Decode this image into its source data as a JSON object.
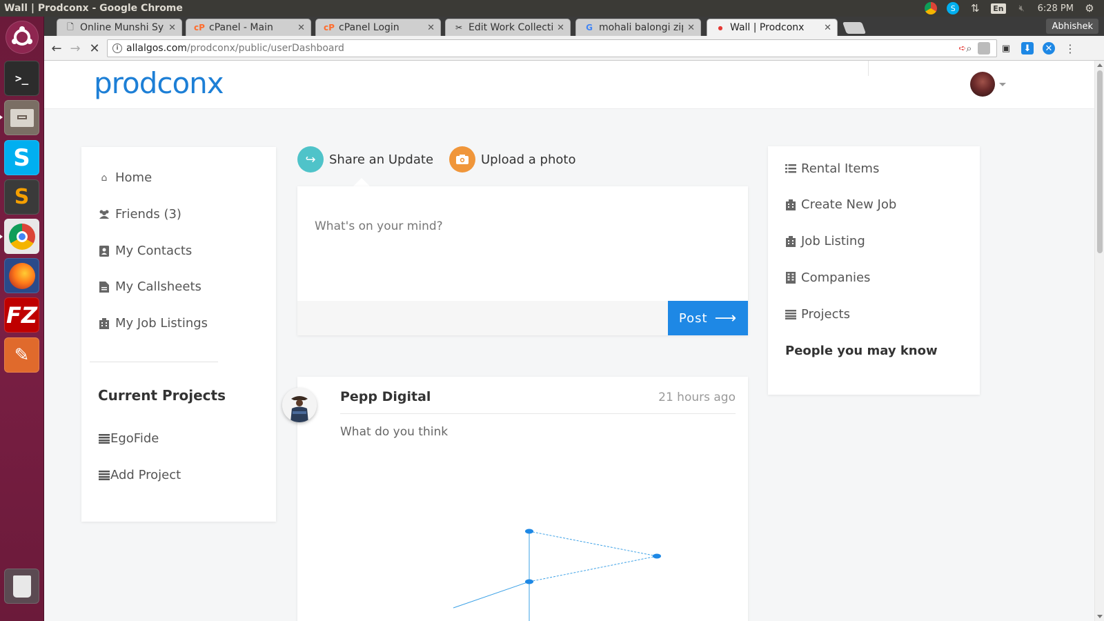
{
  "window": {
    "title": "Wall | Prodconx - Google Chrome",
    "clock": "6:28 PM",
    "keyboard": "En"
  },
  "tabs": [
    {
      "label": "Online Munshi Syst",
      "icon": "page-icon"
    },
    {
      "label": "cPanel - Main",
      "icon": "cpanel-icon"
    },
    {
      "label": "cPanel Login",
      "icon": "cpanel-icon"
    },
    {
      "label": "Edit Work Collectio",
      "icon": "edit-icon"
    },
    {
      "label": "mohali balongi zip c",
      "icon": "google-icon"
    },
    {
      "label": "Wall | Prodconx",
      "icon": "loading-icon"
    }
  ],
  "profile_name": "Abhishek",
  "address": {
    "host": "allalgos.com",
    "path": "/prodconx/public/userDashboard"
  },
  "site": {
    "logo": "prodconx"
  },
  "left_menu": {
    "items": [
      {
        "label": "Home",
        "icon": "home-icon"
      },
      {
        "label": "Friends (3)",
        "icon": "users-icon"
      },
      {
        "label": "My Contacts",
        "icon": "contact-book-icon"
      },
      {
        "label": "My Callsheets",
        "icon": "document-icon"
      },
      {
        "label": "My Job Listings",
        "icon": "building-icon"
      }
    ],
    "projects_title": "Current Projects",
    "projects": [
      {
        "label": "EgoFide",
        "icon": "list-icon"
      },
      {
        "label": "Add Project",
        "icon": "list-icon"
      }
    ]
  },
  "composer": {
    "tab_share": "Share an Update",
    "tab_photo": "Upload a photo",
    "placeholder": "What's on your mind?",
    "post_label": "Post",
    "colors": {
      "share": "#4fc3c9",
      "photo": "#f0963a",
      "post": "#1e88e5"
    }
  },
  "feed": {
    "author": "Pepp Digital",
    "time": "21 hours ago",
    "text": "What do you think"
  },
  "right_menu": {
    "items": [
      {
        "label": "Rental Items",
        "icon": "list-icon"
      },
      {
        "label": "Create New Job",
        "icon": "building-icon"
      },
      {
        "label": "Job Listing",
        "icon": "building-icon"
      },
      {
        "label": "Companies",
        "icon": "building-icon"
      },
      {
        "label": "Projects",
        "icon": "list-icon"
      }
    ],
    "people_title": "People you may know"
  }
}
